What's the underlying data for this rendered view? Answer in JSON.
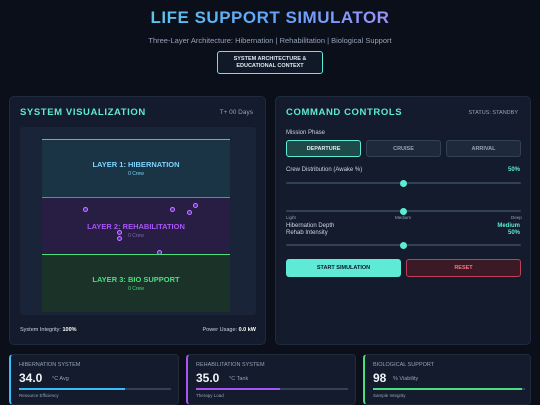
{
  "header": {
    "title": "LIFE SUPPORT SIMULATOR",
    "subtitle": "Three-Layer Architecture: Hibernation | Rehabilitation | Biological Support",
    "context_button": "SYSTEM ARCHITECTURE & EDUCATIONAL CONTEXT"
  },
  "visualization": {
    "title": "SYSTEM VISUALIZATION",
    "time": "T+ 00 Days",
    "layers": [
      {
        "name": "LAYER 1: HIBERNATION",
        "crew": "0 Crew"
      },
      {
        "name": "LAYER 2: REHABILITATION",
        "crew": "0 Crew"
      },
      {
        "name": "LAYER 3: BIO SUPPORT",
        "crew": "0 Crew"
      }
    ],
    "integrity_label": "System Integrity:",
    "integrity_value": "100%",
    "power_label": "Power Usage:",
    "power_value": "0.0 kW"
  },
  "controls": {
    "title": "COMMAND CONTROLS",
    "status": "STATUS: STANDBY",
    "phase_label": "Mission Phase",
    "phases": [
      "DEPARTURE",
      "CRUISE",
      "ARRIVAL"
    ],
    "active_phase": "DEPARTURE",
    "crew_label": "Crew Distribution (Awake %)",
    "crew_value": "50%",
    "crew_level": 0.5,
    "hibernation_label": "Hibernation Depth",
    "hibernation_value": "Medium",
    "hibernation_level": 0.5,
    "hibernation_ticks": [
      "Light",
      "Medium",
      "Deep"
    ],
    "rehab_label": "Rehab Intensity",
    "rehab_value": "50%",
    "rehab_level": 0.5,
    "start_label": "START SIMULATION",
    "reset_label": "RESET"
  },
  "stats": [
    {
      "name": "HIBERNATION SYSTEM",
      "value": "34.0",
      "unit": "°C Avg",
      "note": "Resource Efficiency",
      "level": 0.7,
      "color": "#38bdf8"
    },
    {
      "name": "REHABILITATION SYSTEM",
      "value": "35.0",
      "unit": "°C Tank",
      "note": "Therapy Load",
      "level": 0.55,
      "color": "#a855f7"
    },
    {
      "name": "BIOLOGICAL SUPPORT",
      "value": "98",
      "unit": "% Viability",
      "note": "Sample Integrity",
      "level": 0.98,
      "color": "#4ade80"
    }
  ],
  "colors": {
    "accent": "#5eead4",
    "hibernation": "#38bdf8",
    "rehabilitation": "#a855f7",
    "bio": "#4ade80",
    "danger": "#fb7185"
  }
}
